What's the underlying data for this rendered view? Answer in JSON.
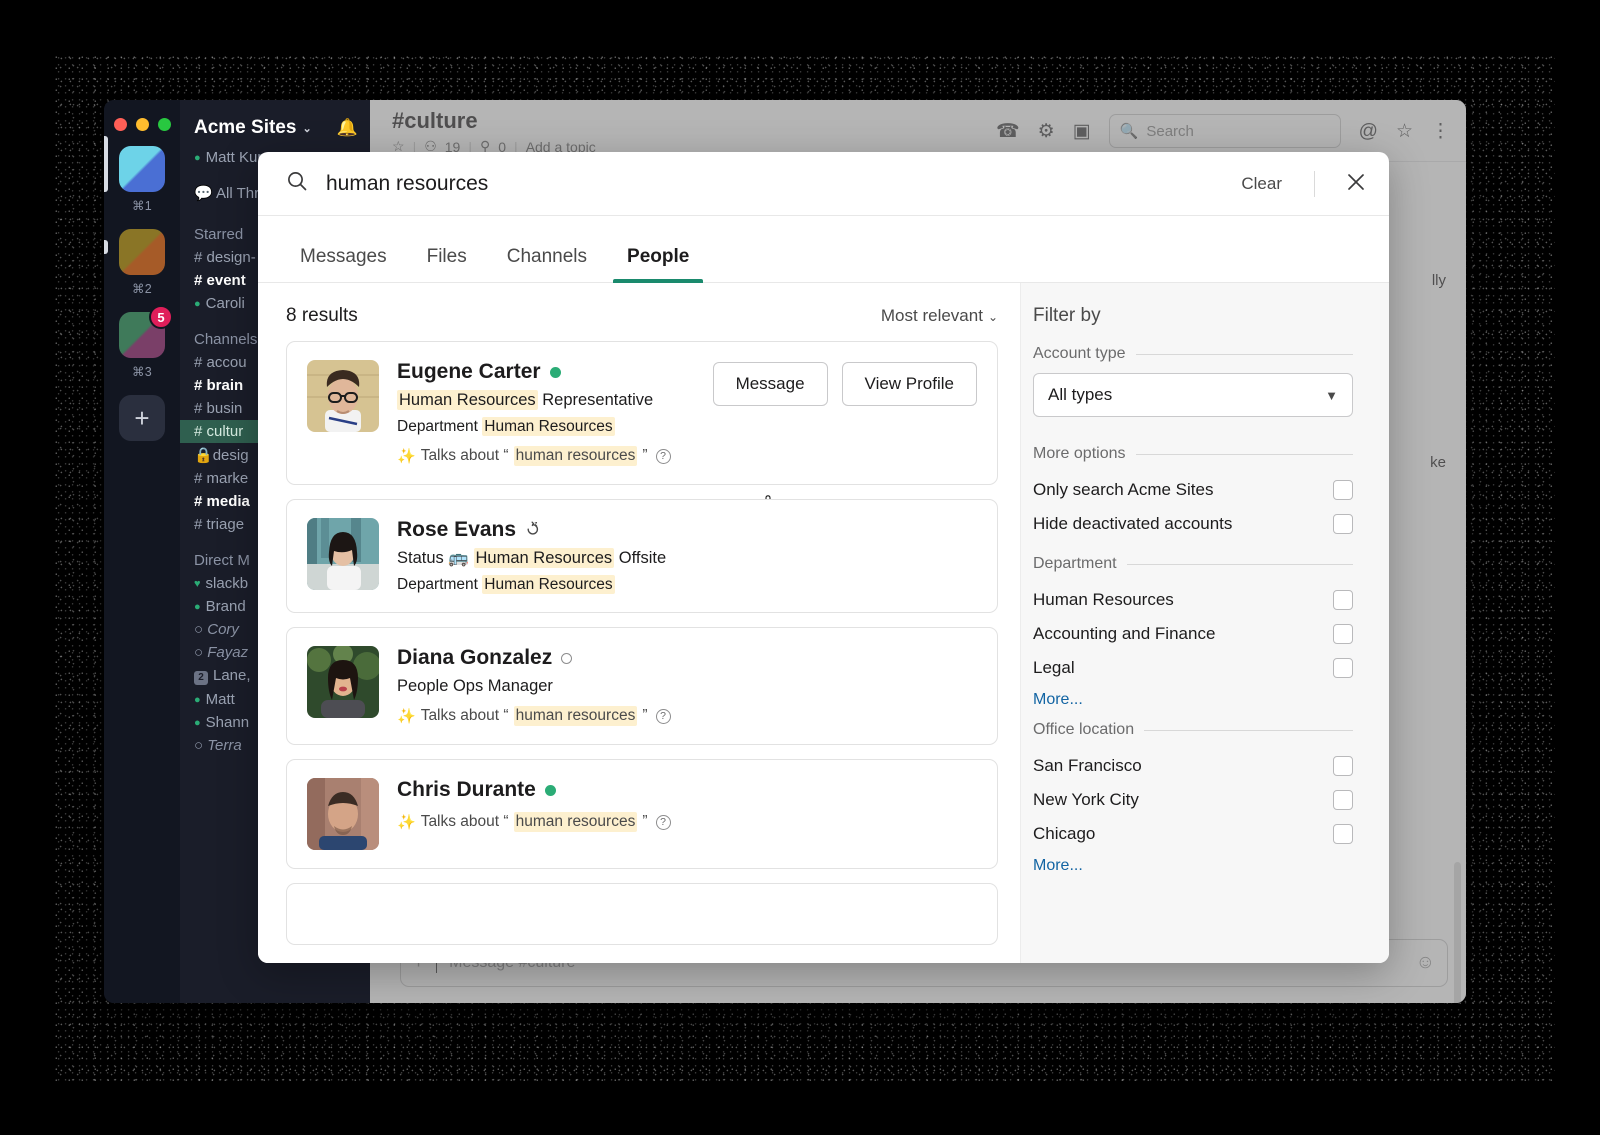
{
  "app": {
    "workspace_title": "Acme Sites",
    "workspace_caret": "⌄",
    "current_user": "Matt Kump",
    "all_threads": "All Threads",
    "workspace_keys": [
      "⌘1",
      "⌘2",
      "⌘3"
    ],
    "workspace_badge": "5",
    "add_workspace_label": "+",
    "sections": [
      {
        "title": "Starred",
        "items": [
          {
            "prefix": "#",
            "label": "design-",
            "bold": false,
            "italic": false,
            "active": false
          },
          {
            "prefix": "#",
            "label": "event",
            "bold": true,
            "italic": false,
            "active": false
          },
          {
            "prefix": "●",
            "label": "Caroli",
            "bold": false,
            "italic": false,
            "active": false
          }
        ]
      },
      {
        "title": "Channels",
        "items": [
          {
            "prefix": "#",
            "label": "accou",
            "bold": false,
            "italic": false,
            "active": false
          },
          {
            "prefix": "#",
            "label": "brain",
            "bold": true,
            "italic": false,
            "active": false
          },
          {
            "prefix": "#",
            "label": "busin",
            "bold": false,
            "italic": false,
            "active": false
          },
          {
            "prefix": "#",
            "label": "cultur",
            "bold": false,
            "italic": false,
            "active": true
          },
          {
            "prefix": "🔒",
            "label": "desig",
            "bold": false,
            "italic": false,
            "active": false
          },
          {
            "prefix": "#",
            "label": "marke",
            "bold": false,
            "italic": false,
            "active": false
          },
          {
            "prefix": "#",
            "label": "media",
            "bold": true,
            "italic": false,
            "active": false
          },
          {
            "prefix": "#",
            "label": "triage",
            "bold": false,
            "italic": false,
            "active": false
          }
        ]
      },
      {
        "title": "Direct M",
        "items": [
          {
            "prefix": "♥",
            "label": "slackb",
            "bold": false,
            "italic": false,
            "active": false
          },
          {
            "prefix": "●",
            "label": "Brand",
            "bold": false,
            "italic": false,
            "active": false
          },
          {
            "prefix": "○",
            "label": "Cory",
            "bold": false,
            "italic": true,
            "active": false
          },
          {
            "prefix": "○",
            "label": "Fayaz",
            "bold": false,
            "italic": true,
            "active": false
          },
          {
            "prefix": "2",
            "label": "Lane,",
            "bold": false,
            "italic": false,
            "active": false
          },
          {
            "prefix": "●",
            "label": "Matt",
            "bold": false,
            "italic": false,
            "active": false
          },
          {
            "prefix": "●",
            "label": "Shann",
            "bold": false,
            "italic": false,
            "active": false
          },
          {
            "prefix": "○",
            "label": "Terra",
            "bold": false,
            "italic": true,
            "active": false
          }
        ]
      }
    ],
    "channel": {
      "name": "#culture",
      "members": "19",
      "pins": "0",
      "topic": "Add a topic",
      "star_icon": "☆",
      "person_icon": "⚇",
      "pin_icon": "⚲"
    },
    "header_icons": {
      "call": "call-icon",
      "settings": "gear-icon",
      "split": "split-view-icon",
      "mention": "@",
      "star": "☆",
      "more": "⋮"
    },
    "header_search_placeholder": "Search",
    "message_fragments": [
      "lly",
      "ke"
    ],
    "composer_placeholder": "Message #culture",
    "composer_plus": "+",
    "composer_emoji": "☺"
  },
  "modal": {
    "search_query": "human resources",
    "search_icon": "search-icon",
    "clear_label": "Clear",
    "close_label": "✕",
    "tabs": [
      {
        "label": "Messages",
        "active": false
      },
      {
        "label": "Files",
        "active": false
      },
      {
        "label": "Channels",
        "active": false
      },
      {
        "label": "People",
        "active": true
      }
    ],
    "results_count": "8 results",
    "sort_label": "Most relevant",
    "sort_caret": "⌄",
    "results": [
      {
        "name": "Eugene Carter",
        "presence": "online",
        "title_pre": "",
        "title_hl": "Human Resources",
        "title_post": " Representative",
        "dept_label": "Department",
        "dept_value": "Human Resources",
        "talks_prefix": "Talks about “",
        "talks_term": "human resources",
        "talks_suffix": "”",
        "has_actions": true,
        "message_button": "Message",
        "view_profile_button": "View Profile",
        "avatar": "eugene-carter-avatar"
      },
      {
        "name": "Rose Evans",
        "presence": "away",
        "status_label": "Status",
        "status_emoji": "🚌",
        "status_hl": "Human Resources",
        "status_post": " Offsite",
        "dept_label": "Department",
        "dept_value": "Human Resources",
        "has_actions": false,
        "avatar": "rose-evans-avatar"
      },
      {
        "name": "Diana Gonzalez",
        "presence": "offline",
        "title_plain": "People Ops Manager",
        "talks_prefix": "Talks about “",
        "talks_term": "human resources",
        "talks_suffix": "”",
        "has_actions": false,
        "avatar": "diana-gonzalez-avatar"
      },
      {
        "name": "Chris Durante",
        "presence": "online",
        "talks_prefix": "Talks about “",
        "talks_term": "human resources",
        "talks_suffix": "”",
        "has_actions": false,
        "avatar": "chris-durante-avatar"
      }
    ],
    "filter": {
      "title": "Filter by",
      "account_type_group": "Account type",
      "account_type_value": "All types",
      "more_options_group": "More options",
      "more_options": [
        {
          "label": "Only search Acme Sites",
          "checked": false
        },
        {
          "label": "Hide deactivated accounts",
          "checked": false
        }
      ],
      "department_group": "Department",
      "departments": [
        {
          "label": "Human Resources",
          "checked": false
        },
        {
          "label": "Accounting and Finance",
          "checked": false
        },
        {
          "label": "Legal",
          "checked": false
        }
      ],
      "department_more": "More...",
      "office_group": "Office location",
      "offices": [
        {
          "label": "San Francisco",
          "checked": false
        },
        {
          "label": "New York City",
          "checked": false
        },
        {
          "label": "Chicago",
          "checked": false
        }
      ],
      "office_more": "More..."
    }
  },
  "colors": {
    "accent_green": "#1a8a6d",
    "highlight_yellow": "#fdf0cf",
    "link_blue": "#1264a3",
    "sidebar_bg": "#1a1d29",
    "presence_online": "#2bac76"
  }
}
